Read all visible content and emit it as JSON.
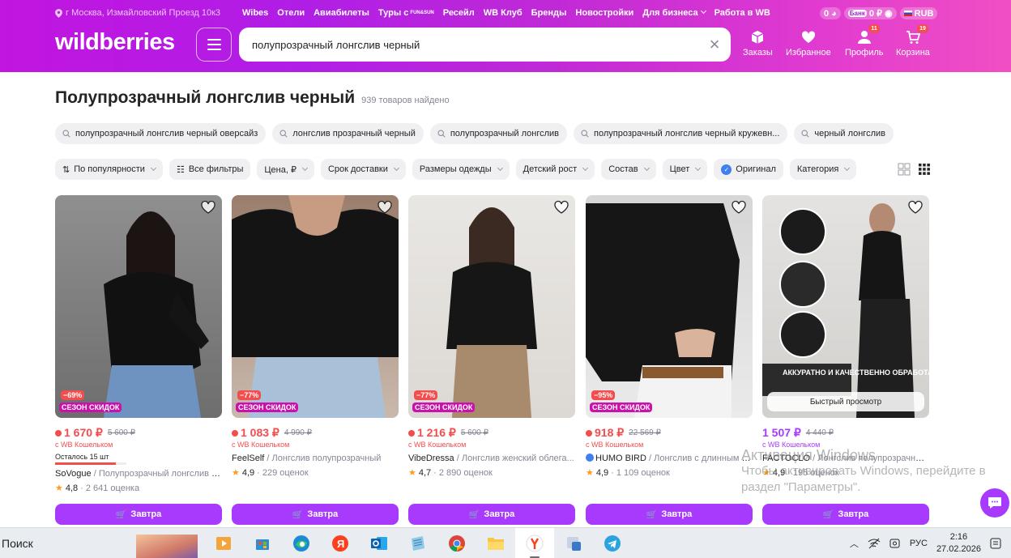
{
  "header": {
    "location": "г Москва, Измайловский Проезд 10к3",
    "top_links": [
      "Wibes",
      "Отели",
      "Авиабилеты",
      "Туры с",
      "Ресейл",
      "WB Клуб",
      "Бренды",
      "Новостройки",
      "Для бизнеса",
      "Работа в WB"
    ],
    "funsun": "FUN&SUN",
    "wallet_points": "0",
    "bank_label": "Банк",
    "bank_balance": "0 ₽",
    "currency": "RUB",
    "logo": "wildberries",
    "search_value": "полупрозрачный лонгслив черный",
    "nav": {
      "orders": "Заказы",
      "favorites": "Избранное",
      "profile": "Профиль",
      "profile_badge": "11",
      "cart": "Корзина",
      "cart_badge": "19"
    }
  },
  "page": {
    "title": "Полупрозрачный лонгслив черный",
    "count": "939 товаров найдено"
  },
  "suggestions": [
    "полупрозрачный лонгслив черный оверсайз",
    "лонгслив прозрачный черный",
    "полупрозрачный лонгслив",
    "полупрозрачный лонгслив черный кружевн...",
    "черный лонгслив"
  ],
  "filters": {
    "sort": "По популярности",
    "all": "Все фильтры",
    "price": "Цена, ₽",
    "delivery": "Срок доставки",
    "sizes": "Размеры одежды",
    "kids_height": "Детский рост",
    "composition": "Состав",
    "color": "Цвет",
    "original": "Оригинал",
    "category": "Категория"
  },
  "products": [
    {
      "discount": "−69%",
      "season": "СЕЗОН СКИДОК",
      "price": "1 670 ₽",
      "old_price": "5 600 ₽",
      "wallet": "с WB Кошельком",
      "stock": "Осталось 15 шт",
      "stock_fraction": 0.85,
      "brand": "SoVogue",
      "name": "Полупрозрачный лонгслив с ...",
      "rating": "4,8",
      "reviews": "2 641 оценка",
      "buy": "Завтра"
    },
    {
      "discount": "−77%",
      "season": "СЕЗОН СКИДОК",
      "price": "1 083 ₽",
      "old_price": "4 990 ₽",
      "wallet": "с WB Кошельком",
      "brand": "FeelSelf",
      "name": "Лонгслив полупрозрачный",
      "rating": "4,9",
      "reviews": "229 оценок",
      "buy": "Завтра"
    },
    {
      "discount": "−77%",
      "season": "СЕЗОН СКИДОК",
      "price": "1 216 ₽",
      "old_price": "5 600 ₽",
      "wallet": "с WB Кошельком",
      "brand": "VibeDressa",
      "name": "Лонгслив женский облега...",
      "rating": "4,7",
      "reviews": "2 890 оценок",
      "buy": "Завтра"
    },
    {
      "discount": "−95%",
      "season": "СЕЗОН СКИДОК",
      "price": "918 ₽",
      "old_price": "22 569 ₽",
      "wallet": "с WB Кошельком",
      "brand": "HUMO BIRD",
      "name": "Лонгслив с длинным ру...",
      "rating": "4,9",
      "reviews": "1 109 оценок",
      "buy": "Завтра"
    },
    {
      "quick": "Быстрый просмотр",
      "price": "1 507 ₽",
      "old_price": "4 440 ₽",
      "wallet": "с WB Кошельком",
      "brand": "FACTOCLO",
      "name": "Лонгслив полупрозрачный...",
      "rating": "4,9",
      "reviews": "195 оценок",
      "buy": "Завтра",
      "overlay_text": "АККУРАТНО И КАЧЕСТВЕННО ОБРАБОТАНЫ КРАЯ"
    }
  ],
  "watermark": {
    "title": "Активация Windows",
    "line1": "Чтобы активировать Windows, перейдите в",
    "line2": "раздел \"Параметры\"."
  },
  "taskbar": {
    "search": "Поиск",
    "lang": "РУС",
    "time": "2:16",
    "date": "27.02.2026"
  },
  "colors": {
    "accent": "#a73afd",
    "sale": "#f34d4d",
    "season": "#cb11ab"
  }
}
